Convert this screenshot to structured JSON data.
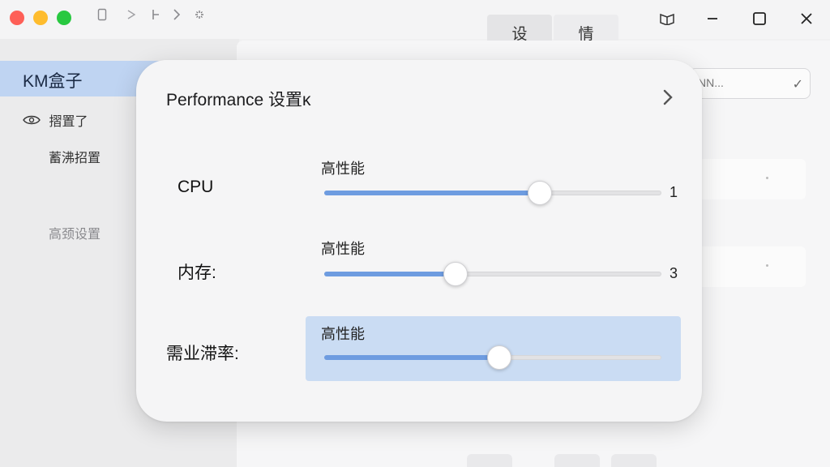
{
  "titlebar": {
    "tabs": [
      {
        "label": "设"
      },
      {
        "label": "情"
      }
    ]
  },
  "sidebar": {
    "app_title": "KM盒子",
    "items": [
      {
        "label": "摺置了",
        "icon": "eye-icon"
      },
      {
        "label": "蓄沸招置"
      },
      {
        "label": "高颈设置"
      }
    ]
  },
  "background": {
    "field_text": "NN..."
  },
  "dialog": {
    "title": "Performance 设置κ",
    "rows": [
      {
        "label": "CPU",
        "mode": "高性能",
        "value": 0.64,
        "value_text": "1",
        "highlighted": false
      },
      {
        "label": "内存:",
        "mode": "高性能",
        "value": 0.39,
        "value_text": "3",
        "highlighted": false
      },
      {
        "label": "需业滞率:",
        "mode": "高性能",
        "value": 0.52,
        "value_text": "",
        "highlighted": true
      }
    ]
  },
  "colors": {
    "accent": "#6e9ce0",
    "selection": "#bfd4f2",
    "highlight": "#cadcf3"
  }
}
